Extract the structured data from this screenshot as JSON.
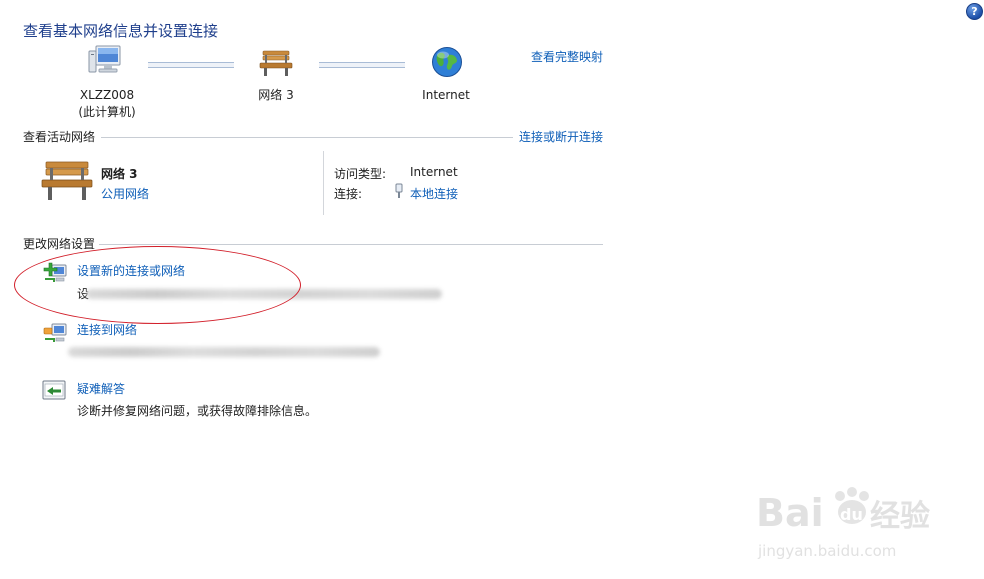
{
  "page": {
    "title": "查看基本网络信息并设置连接",
    "full_map_link": "查看完整映射",
    "help_glyph": "?"
  },
  "network_map": {
    "computer": {
      "name": "XLZZ008",
      "subtitle": "(此计算机)"
    },
    "network": {
      "name": "网络  3"
    },
    "internet": {
      "name": "Internet"
    }
  },
  "active_networks": {
    "header": "查看活动网络",
    "action_link": "连接或断开连接",
    "network": {
      "name": "网络  3",
      "type_link": "公用网络",
      "access_type_label": "访问类型:",
      "access_type_value": "Internet",
      "connection_label": "连接:",
      "connection_value": "本地连接"
    }
  },
  "change_settings": {
    "header": "更改网络设置",
    "tasks": [
      {
        "title": "设置新的连接或网络",
        "desc_visible_char": "设",
        "icon": "new-connection-icon"
      },
      {
        "title": "连接到网络",
        "desc_visible_char": "",
        "icon": "connect-network-icon"
      },
      {
        "title": "疑难解答",
        "desc": "诊断并修复网络问题，或获得故障排除信息。",
        "icon": "troubleshoot-icon"
      }
    ]
  },
  "watermark": {
    "brand": "Bai",
    "brand2": "du",
    "suffix": "经验",
    "url": "jingyan.baidu.com"
  },
  "colors": {
    "link": "#0f5fb8",
    "title": "#1f3f8c",
    "highlight_ellipse": "#d21f2a"
  }
}
